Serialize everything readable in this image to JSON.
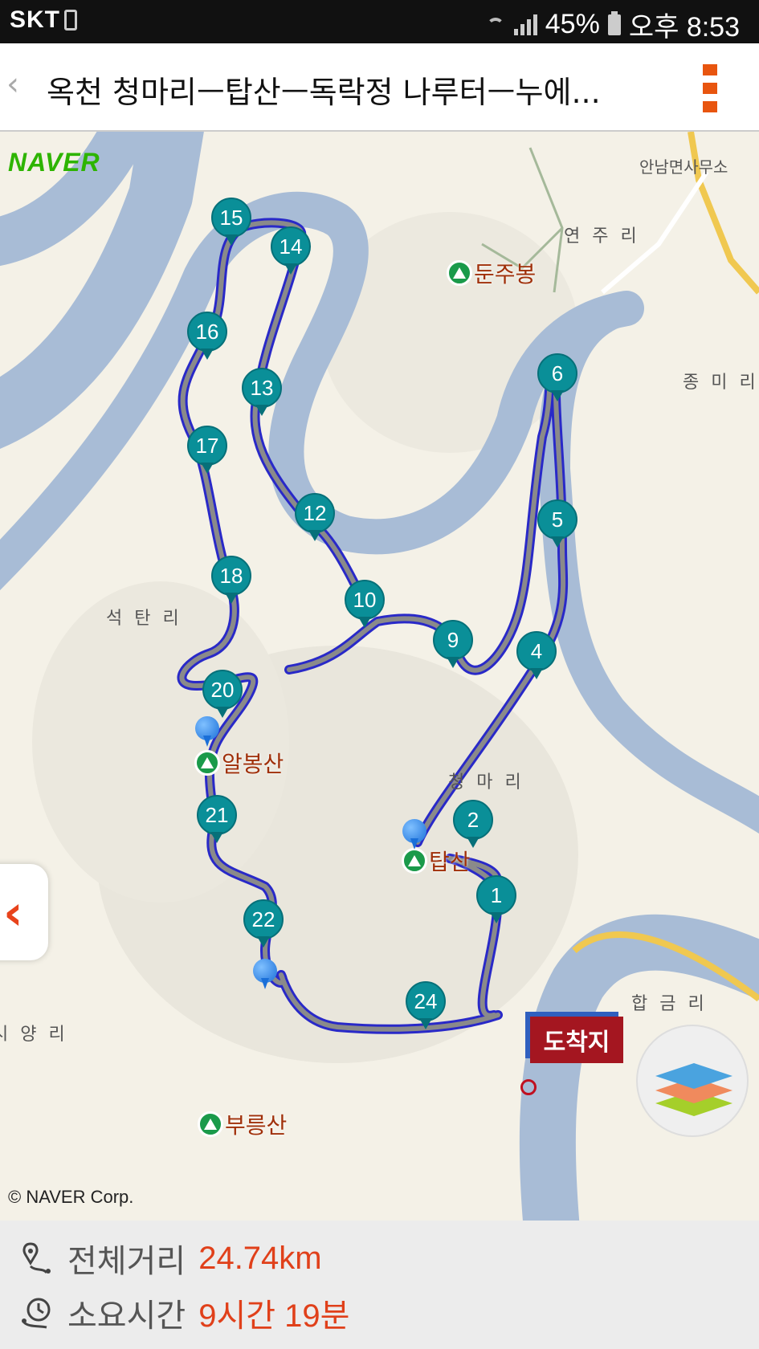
{
  "status_bar": {
    "carrier": "SKT",
    "battery": "45%",
    "time": "오후 8:53"
  },
  "header": {
    "back_icon": "chevron-left-icon",
    "title": "옥천  청마리ㅡ탑산ㅡ독락정 나루터ㅡ누에...",
    "menu_icon": "more-vertical-icon",
    "accent_color": "#e8550f"
  },
  "map": {
    "logo": "NAVER",
    "copyright": "© NAVER Corp.",
    "places": [
      "안남면사무소",
      "연 주 리",
      "종 미 리",
      "석 탄 리",
      "청 마 리",
      "합 금 리",
      "시 양 리"
    ],
    "peaks": [
      "둔주봉",
      "알봉산",
      "탑산",
      "부릉산"
    ],
    "waypoints": [
      "15",
      "14",
      "16",
      "13",
      "6",
      "17",
      "12",
      "5",
      "18",
      "10",
      "9",
      "4",
      "20",
      "21",
      "2",
      "1",
      "22",
      "24"
    ],
    "destination_label": "도착지",
    "route_color": "#2929c8",
    "river_color": "#a8bcd6"
  },
  "info": {
    "distance_label": "전체거리",
    "distance_value": "24.74km",
    "time_label": "소요시간",
    "time_value": "9시간 19분"
  }
}
